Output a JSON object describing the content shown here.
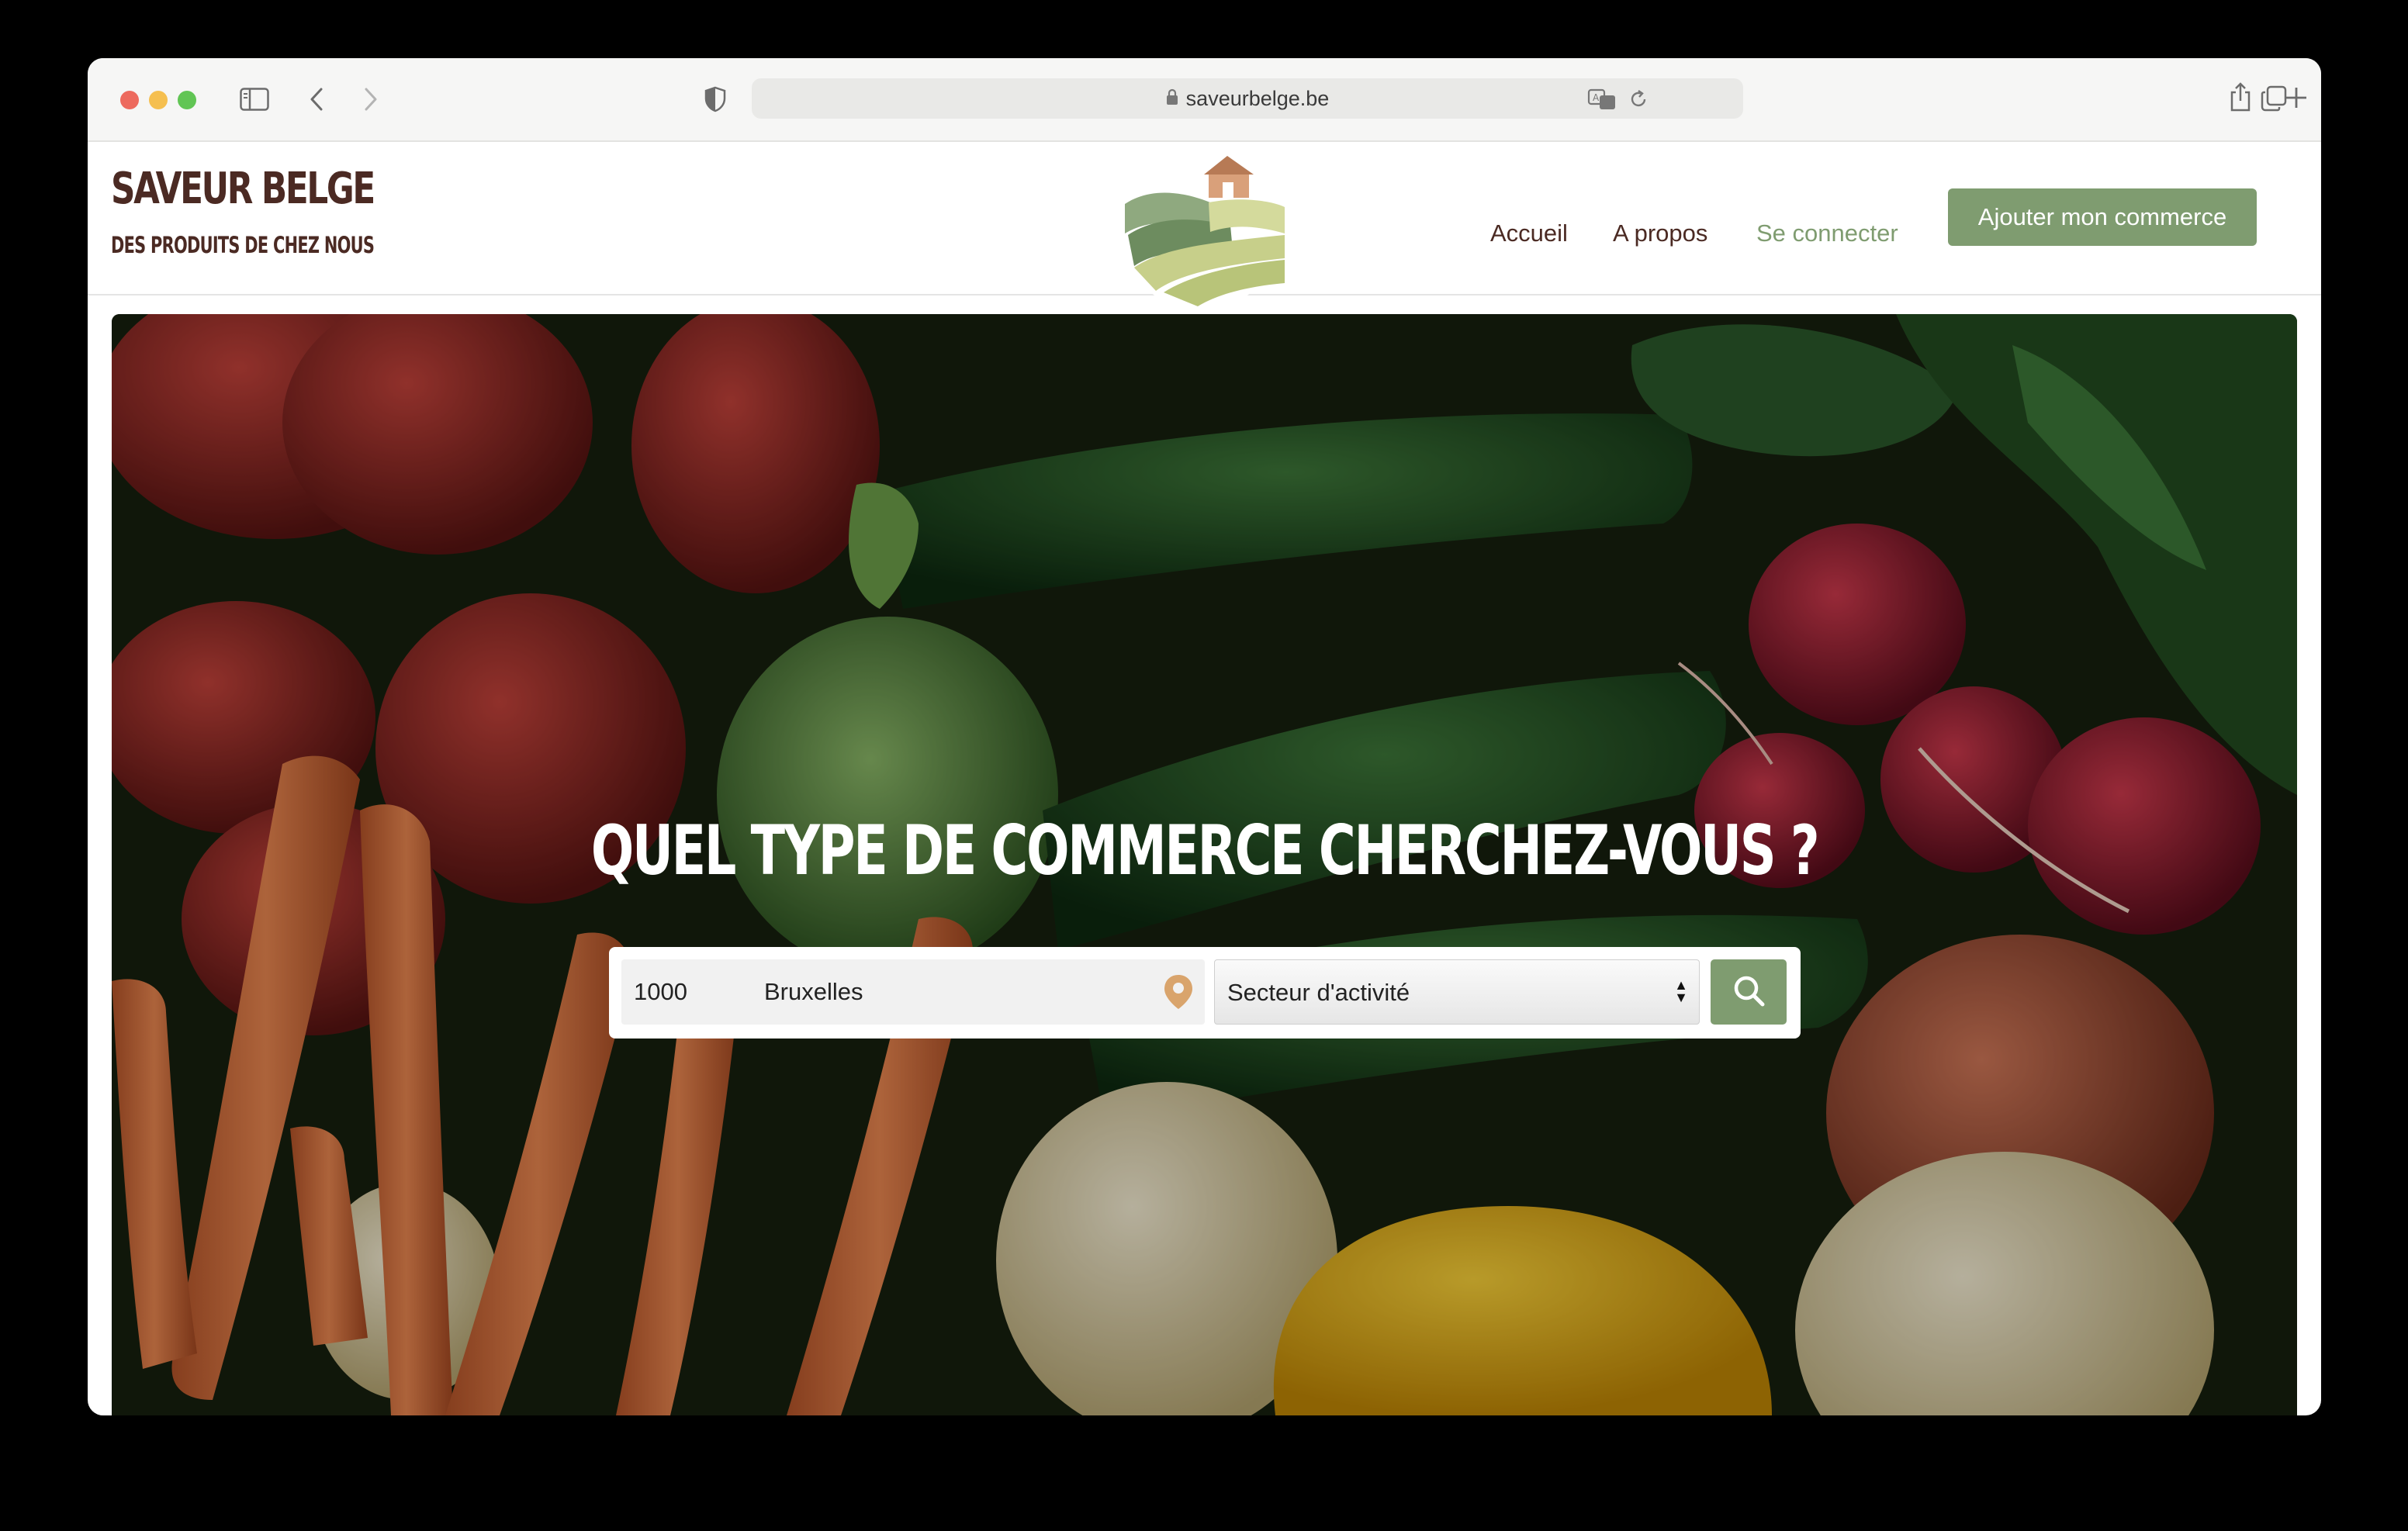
{
  "browser": {
    "url": "saveurbelge.be",
    "icons": [
      "sidebar-icon",
      "back-icon",
      "forward-icon",
      "shield-icon",
      "lock-icon",
      "translate-icon",
      "reload-icon",
      "share-icon",
      "new-tab-icon",
      "tabs-overview-icon"
    ]
  },
  "site": {
    "brand_title": "SAVEUR BELGE",
    "brand_subtitle": "DES PRODUITS DE CHEZ NOUS",
    "nav": {
      "home": "Accueil",
      "about": "A propos",
      "login": "Se connecter",
      "cta": "Ajouter mon commerce"
    }
  },
  "hero": {
    "headline": "QUEL TYPE DE COMMERCE CHERCHEZ-VOUS ?",
    "search": {
      "zip": "1000",
      "city": "Bruxelles",
      "sector_selected": "Secteur d'activité"
    }
  },
  "colors": {
    "brand_brown": "#4b2a23",
    "accent_green": "#7f9c70",
    "pin_orange": "#d9a46c"
  }
}
